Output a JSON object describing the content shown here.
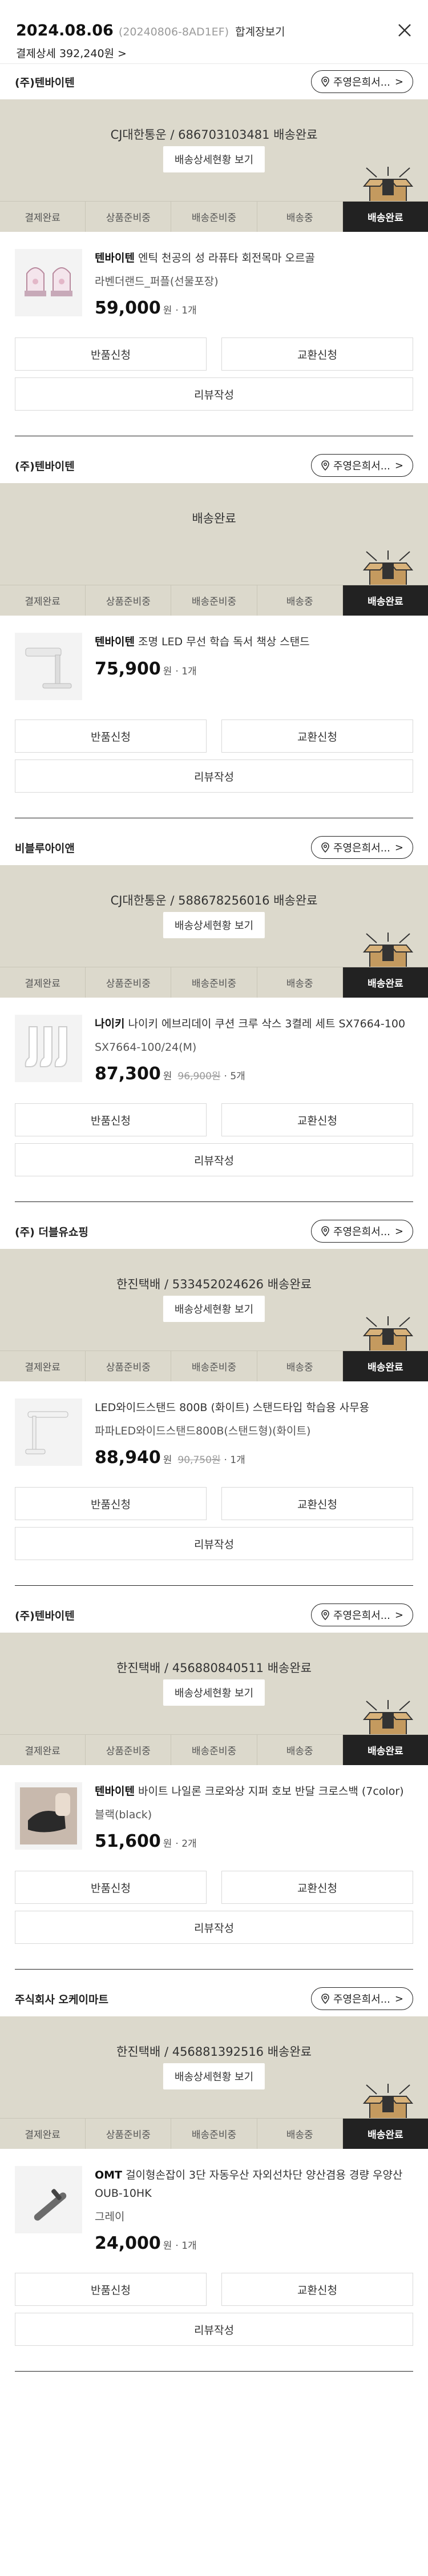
{
  "header": {
    "date": "2024.08.06",
    "order_no": "(20240806-8AD1EF)",
    "combine_label": "합계장보기",
    "pay_detail_label": "결제상세 392,240원",
    "pay_detail_chev": ">"
  },
  "common": {
    "shop_btn_label": "주영은희서...",
    "shop_btn_chev": ">",
    "track_btn_label": "배송상세현황 보기",
    "steps": [
      "결제완료",
      "상품준비중",
      "배송준비중",
      "배송중",
      "배송완료"
    ],
    "won": "원",
    "return_label": "반품신청",
    "exchange_label": "교환신청",
    "review_label": "리뷰작성"
  },
  "shops": [
    {
      "name": "(주)텐바이텐",
      "carrier": "CJ대한통운 / 686703103481 배송완료",
      "has_track": true,
      "brand": "텐바이텐",
      "product": " 엔틱 천공의 성 라퓨타 회전목마 오르골",
      "option": "라벤더랜드_퍼플(선물포장)",
      "price": "59,000",
      "orig_price": "",
      "qty": "· 1개",
      "thumb": "carousel"
    },
    {
      "name": "(주)텐바이텐",
      "carrier": "배송완료",
      "has_track": false,
      "brand": "텐바이텐",
      "product": " 조명 LED 무선 학습 독서 책상 스탠드",
      "option": "",
      "price": "75,900",
      "orig_price": "",
      "qty": "· 1개",
      "thumb": "lamp"
    },
    {
      "name": "비블루아이앤",
      "carrier": "CJ대한통운 / 588678256016 배송완료",
      "has_track": true,
      "brand": "나이키",
      "product": " 나이키 에브리데이 쿠션 크루 삭스 3켤레 세트 SX7664-100",
      "option": "SX7664-100/24(M)",
      "price": "87,300",
      "orig_price": "96,900원",
      "qty": "· 5개",
      "thumb": "socks"
    },
    {
      "name": "(주) 더블유쇼핑",
      "carrier": "한진택배 / 533452024626 배송완료",
      "has_track": true,
      "brand": "",
      "product": "LED와이드스탠드 800B (화이트) 스탠드타입 학습용 사무용",
      "option": "파파LED와이드스탠드800B(스탠드형)(화이트)",
      "price": "88,940",
      "orig_price": "90,750원",
      "qty": "· 1개",
      "thumb": "desklamp"
    },
    {
      "name": "(주)텐바이텐",
      "carrier": "한진택배 / 456880840511 배송완료",
      "has_track": true,
      "brand": "텐바이텐",
      "product": " 바이트 나일론 크로와상 지퍼 호보 반달 크로스백 (7color)",
      "option": "블랙(black)",
      "price": "51,600",
      "orig_price": "",
      "qty": "· 2개",
      "thumb": "bag"
    },
    {
      "name": "주식회사 오케이마트",
      "carrier": "한진택배 / 456881392516 배송완료",
      "has_track": true,
      "brand": "OMT",
      "product": " 걸이형손잡이 3단 자동우산 자외선차단 양산겸용 경량 우양산 OUB-10HK",
      "option": "그레이",
      "price": "24,000",
      "orig_price": "",
      "qty": "· 1개",
      "thumb": "umbrella"
    }
  ]
}
